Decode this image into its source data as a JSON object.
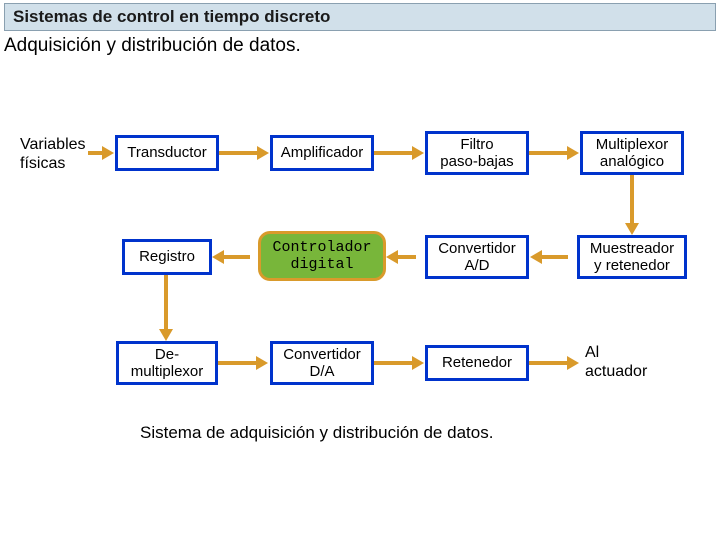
{
  "title": "Sistemas de control en tiempo discreto",
  "subtitle": "Adquisición y distribución de datos.",
  "labels": {
    "input": "Variables\nfísicas",
    "output": "Al\nactuador"
  },
  "nodes": {
    "transductor": "Transductor",
    "amplificador": "Amplificador",
    "filtro": "Filtro\npaso-bajas",
    "mux": "Multiplexor\nanalógico",
    "registro": "Registro",
    "controlador": "Controlador\ndigital",
    "adc": "Convertidor\nA/D",
    "sh": "Muestreador\ny retenedor",
    "demux": "De-\nmultiplexor",
    "dac": "Convertidor\nD/A",
    "retenedor": "Retenedor"
  },
  "caption": "Sistema de adquisición y distribución de datos."
}
